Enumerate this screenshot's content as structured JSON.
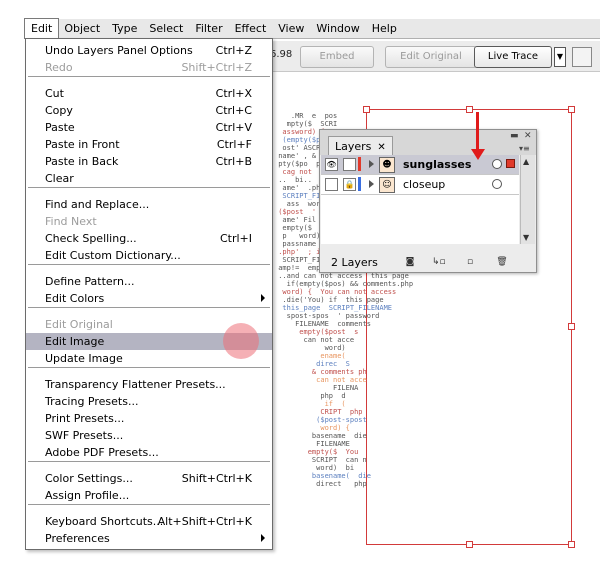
{
  "menubar": {
    "items": [
      "Edit",
      "Object",
      "Type",
      "Select",
      "Filter",
      "Effect",
      "View",
      "Window",
      "Help"
    ]
  },
  "toolbar": {
    "value": "6.98",
    "embed": "Embed",
    "edit_original": "Edit Original",
    "live_trace": "Live Trace"
  },
  "edit_menu": {
    "items": [
      {
        "label": "Undo Layers Panel Options",
        "shortcut": "Ctrl+Z",
        "disabled": false
      },
      {
        "label": "Redo",
        "shortcut": "Shift+Ctrl+Z",
        "disabled": true
      },
      {
        "label": "Cut",
        "shortcut": "Ctrl+X",
        "disabled": false
      },
      {
        "label": "Copy",
        "shortcut": "Ctrl+C",
        "disabled": false
      },
      {
        "label": "Paste",
        "shortcut": "Ctrl+V",
        "disabled": false
      },
      {
        "label": "Paste in Front",
        "shortcut": "Ctrl+F",
        "disabled": false
      },
      {
        "label": "Paste in Back",
        "shortcut": "Ctrl+B",
        "disabled": false
      },
      {
        "label": "Clear",
        "shortcut": "",
        "disabled": false
      },
      {
        "label": "Find and Replace...",
        "shortcut": "",
        "disabled": false
      },
      {
        "label": "Find Next",
        "shortcut": "",
        "disabled": true
      },
      {
        "label": "Check Spelling...",
        "shortcut": "Ctrl+I",
        "disabled": false
      },
      {
        "label": "Edit Custom Dictionary...",
        "shortcut": "",
        "disabled": false
      },
      {
        "label": "Define Pattern...",
        "shortcut": "",
        "disabled": false
      },
      {
        "label": "Edit Colors",
        "shortcut": "",
        "disabled": false
      },
      {
        "label": "Edit Original",
        "shortcut": "",
        "disabled": true
      },
      {
        "label": "Edit Image",
        "shortcut": "",
        "disabled": false
      },
      {
        "label": "Update Image",
        "shortcut": "",
        "disabled": false
      },
      {
        "label": "Transparency Flattener Presets...",
        "shortcut": "",
        "disabled": false
      },
      {
        "label": "Tracing Presets...",
        "shortcut": "",
        "disabled": false
      },
      {
        "label": "Print Presets...",
        "shortcut": "",
        "disabled": false
      },
      {
        "label": "SWF Presets...",
        "shortcut": "",
        "disabled": false
      },
      {
        "label": "Adobe PDF Presets...",
        "shortcut": "",
        "disabled": false
      },
      {
        "label": "Color Settings...",
        "shortcut": "Shift+Ctrl+K",
        "disabled": false
      },
      {
        "label": "Assign Profile...",
        "shortcut": "",
        "disabled": false
      },
      {
        "label": "Keyboard Shortcuts...",
        "shortcut": "Alt+Shift+Ctrl+K",
        "disabled": false
      },
      {
        "label": "Preferences",
        "shortcut": "",
        "disabled": false
      }
    ],
    "highlighted": "Edit Image"
  },
  "layers_panel": {
    "tab": "Layers",
    "layers": [
      {
        "name": "sunglasses",
        "color": "#e0392b",
        "selected": true
      },
      {
        "name": "closeup",
        "color": "#3b6fe0",
        "selected": false
      }
    ],
    "count": "2 Layers"
  },
  "colors": {
    "accent_red": "#e01b1b",
    "menu_highlight": "#b4b4c2"
  },
  "artwork": {
    "lines": [
      "    .MR  e  pos",
      "   mpty($  SCRI",
      "  assword) {  w",
      "  (empty($pos' p",
      "  ost' ASCRIPT_FI",
      " name' , &  wo",
      " pty($po  password",
      "  cag not  can",
      " ..  bi..  die",
      "  ame'  .php'",
      "  SCRIPT_FILENA",
      "   ass  word)",
      " ($post  ' sc",
      "  ame' Fil  ENAME",
      "  empty($  pos",
      "  p   word) ",
      "  passname  bi",
      " .php'  ; if",
      "  SCRIPT_FILENAME",
      " amp!=  empty($post-spost",
      " ..and can not access  this page",
      "   if(empty($pos) && comments.php",
      "  word) {  You can not access",
      "  .die('You) if  this page",
      "  this_page  SCRIPT_FILENAME",
      "   spost-spos  ' password",
      "     FILENAME  comments",
      "      empty($post  s",
      "       can not acce",
      "            word)",
      "           ename(",
      "          direc  S",
      "         & comments ph",
      "          can not acce",
      "              FILENA",
      "           php  d",
      "            if  (",
      "           CRIPT  php",
      "          ($post-spost",
      "           word) {",
      "         basename  die",
      "          FILENAME",
      "        empty($  You",
      "         SCRIPT  can n",
      "          word)  bi",
      "         basename(  die",
      "          direct   php"
    ]
  }
}
